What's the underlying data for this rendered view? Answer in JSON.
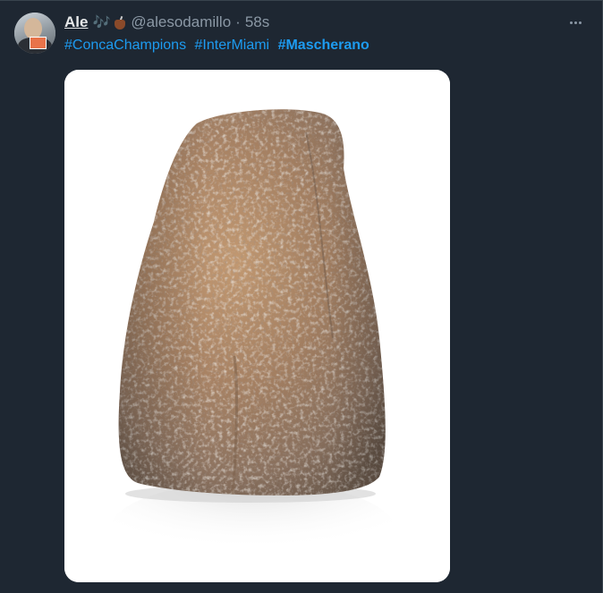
{
  "tweet": {
    "author": {
      "name": "Ale",
      "emoji_1": "🎶",
      "emoji_2": "mate-icon",
      "handle": "@alesodamillo",
      "separator": "·",
      "time": "58s"
    },
    "hashtags": [
      {
        "text": "#ConcaChampions",
        "bold": false
      },
      {
        "text": "#InterMiami",
        "bold": false
      },
      {
        "text": "#Mascherano",
        "bold": true
      }
    ],
    "media": {
      "icon": "rock-photo"
    }
  },
  "colors": {
    "background": "#1e2732",
    "link": "#1d9bf0",
    "text_primary": "#e7e9ea",
    "text_secondary": "#8b98a5"
  }
}
